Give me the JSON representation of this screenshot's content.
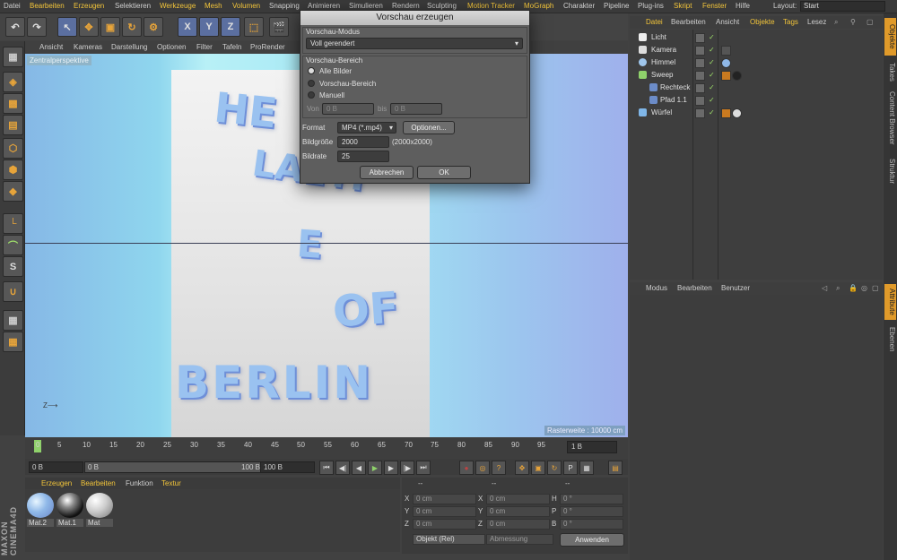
{
  "menubar": {
    "items": [
      "Datei",
      "Bearbeiten",
      "Erzeugen",
      "Selektieren",
      "Werkzeuge",
      "Mesh",
      "Volumen",
      "Snapping",
      "Animieren",
      "Simulieren",
      "Rendern",
      "Sculpting",
      "Motion Tracker",
      "MoGraph",
      "Charakter",
      "Pipeline",
      "Plug-ins",
      "Skript",
      "Fenster",
      "Hilfe"
    ],
    "layout_label": "Layout:",
    "layout_value": "Start"
  },
  "toolbar": {
    "x": "X",
    "y": "Y",
    "z": "Z"
  },
  "viewport": {
    "menu": [
      "Ansicht",
      "Kameras",
      "Darstellung",
      "Optionen",
      "Filter",
      "Tafeln",
      "ProRender"
    ],
    "label": "Zentralperspektive",
    "raster": "Rasterweite : 10000 cm",
    "poster_lines": [
      "HE",
      "LAETI",
      "E",
      "OF",
      "BERLIN"
    ]
  },
  "timeline": {
    "ticks": [
      "0",
      "5",
      "10",
      "15",
      "20",
      "25",
      "30",
      "35",
      "40",
      "45",
      "50",
      "55",
      "60",
      "65",
      "70",
      "75",
      "80",
      "85",
      "90",
      "95"
    ],
    "frame": "1 B",
    "start": "0 B",
    "range_left": "0 B",
    "range_right": "100 B",
    "end": "100 B"
  },
  "materials": {
    "menu": [
      "Erzeugen",
      "Bearbeiten",
      "Funktion",
      "Textur"
    ],
    "items": [
      "Mat.2",
      "Mat.1",
      "Mat"
    ]
  },
  "coords": {
    "headers": [
      "--",
      "--",
      "--"
    ],
    "rows": [
      {
        "a": "X",
        "av": "0 cm",
        "b": "X",
        "bv": "0 cm",
        "c": "H",
        "cv": "0 °"
      },
      {
        "a": "Y",
        "av": "0 cm",
        "b": "Y",
        "bv": "0 cm",
        "c": "P",
        "cv": "0 °"
      },
      {
        "a": "Z",
        "av": "0 cm",
        "b": "Z",
        "bv": "0 cm",
        "c": "B",
        "cv": "0 °"
      }
    ],
    "mode": "Objekt (Rel)",
    "size": "Abmessung",
    "apply": "Anwenden"
  },
  "objects": {
    "menu": [
      "Datei",
      "Bearbeiten",
      "Ansicht",
      "Objekte",
      "Tags",
      "Lesez"
    ],
    "rows": [
      {
        "name": "Licht",
        "indent": 0
      },
      {
        "name": "Kamera",
        "indent": 0
      },
      {
        "name": "Himmel",
        "indent": 0
      },
      {
        "name": "Sweep",
        "indent": 0
      },
      {
        "name": "Rechteck",
        "indent": 1
      },
      {
        "name": "Pfad 1.1",
        "indent": 1
      },
      {
        "name": "Würfel",
        "indent": 0
      }
    ]
  },
  "attributes": {
    "menu": [
      "Modus",
      "Bearbeiten",
      "Benutzer"
    ]
  },
  "right_tabs": [
    "Objekte",
    "Takes",
    "Content Browser",
    "Struktur",
    "Attribute",
    "Ebenen"
  ],
  "dialog": {
    "title": "Vorschau erzeugen",
    "mode_group": "Vorschau-Modus",
    "mode_value": "Voll gerendert",
    "range_group": "Vorschau-Bereich",
    "radio_all": "Alle Bilder",
    "radio_preview": "Vorschau-Bereich",
    "radio_manual": "Manuell",
    "from_label": "Von",
    "from_value": "0 B",
    "to_label": "bis",
    "to_value": "0 B",
    "format_label": "Format",
    "format_value": "MP4 (*.mp4)",
    "options_button": "Optionen...",
    "size_label": "Bildgröße",
    "size_value": "2000",
    "size_info": "(2000x2000)",
    "fps_label": "Bildrate",
    "fps_value": "25",
    "cancel": "Abbrechen",
    "ok": "OK"
  },
  "brand": "MAXON CINEMA4D",
  "colors": {
    "accent": "#f3c53a",
    "active_tab": "#e09a2a",
    "check": "#9fdf6a"
  }
}
